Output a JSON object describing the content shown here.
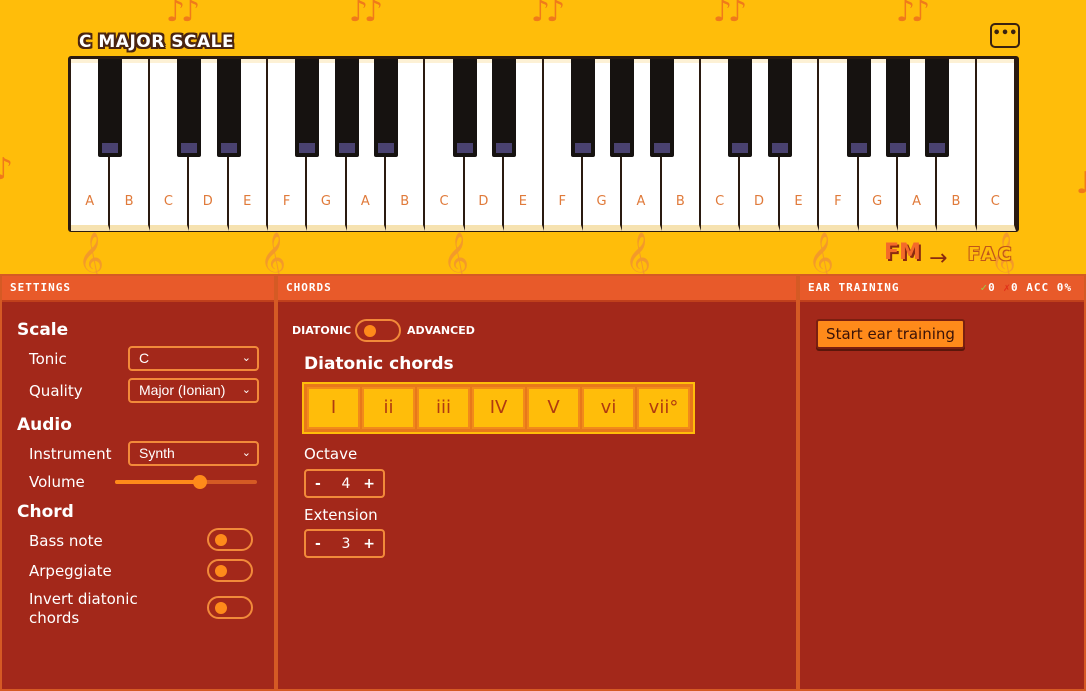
{
  "header": {
    "title": "C MAJOR SCALE",
    "menu_label": "•••"
  },
  "keyboard": {
    "white_keys": [
      "A",
      "B",
      "C",
      "D",
      "E",
      "F",
      "G",
      "A",
      "B",
      "C",
      "D",
      "E",
      "F",
      "G",
      "A",
      "B",
      "C",
      "D",
      "E",
      "F",
      "G",
      "A",
      "B",
      "C"
    ]
  },
  "logo": {
    "left": "FM",
    "arrow": "→",
    "right": "FAC"
  },
  "settings": {
    "header": "SETTINGS",
    "scale_heading": "Scale",
    "tonic_label": "Tonic",
    "tonic_value": "C",
    "quality_label": "Quality",
    "quality_value": "Major (Ionian)",
    "audio_heading": "Audio",
    "instrument_label": "Instrument",
    "instrument_value": "Synth",
    "volume_label": "Volume",
    "volume_level": 0.6,
    "chord_heading": "Chord",
    "bass_note_label": "Bass note",
    "arpeggiate_label": "Arpeggiate",
    "invert_label_1": "Invert diatonic",
    "invert_label_2": "chords"
  },
  "chords": {
    "header": "CHORDS",
    "mode_left": "DIATONIC",
    "mode_right": "ADVANCED",
    "title": "Diatonic chords",
    "buttons": [
      "I",
      "ii",
      "iii",
      "IV",
      "V",
      "vi",
      "vii°"
    ],
    "octave_label": "Octave",
    "octave_value": "4",
    "extension_label": "Extension",
    "extension_value": "3",
    "minus": "-",
    "plus": "+"
  },
  "ear": {
    "header": "EAR TRAINING",
    "correct_mark": "✓",
    "correct_count": "0",
    "wrong_mark": "✗",
    "wrong_count": "0",
    "acc_text": "ACC 0%",
    "start_label": "Start ear training"
  },
  "colors": {
    "background": "#ffbd0a",
    "panel": "#a3281a",
    "panel_header": "#e85a2a",
    "accent": "#ff8a1a"
  }
}
